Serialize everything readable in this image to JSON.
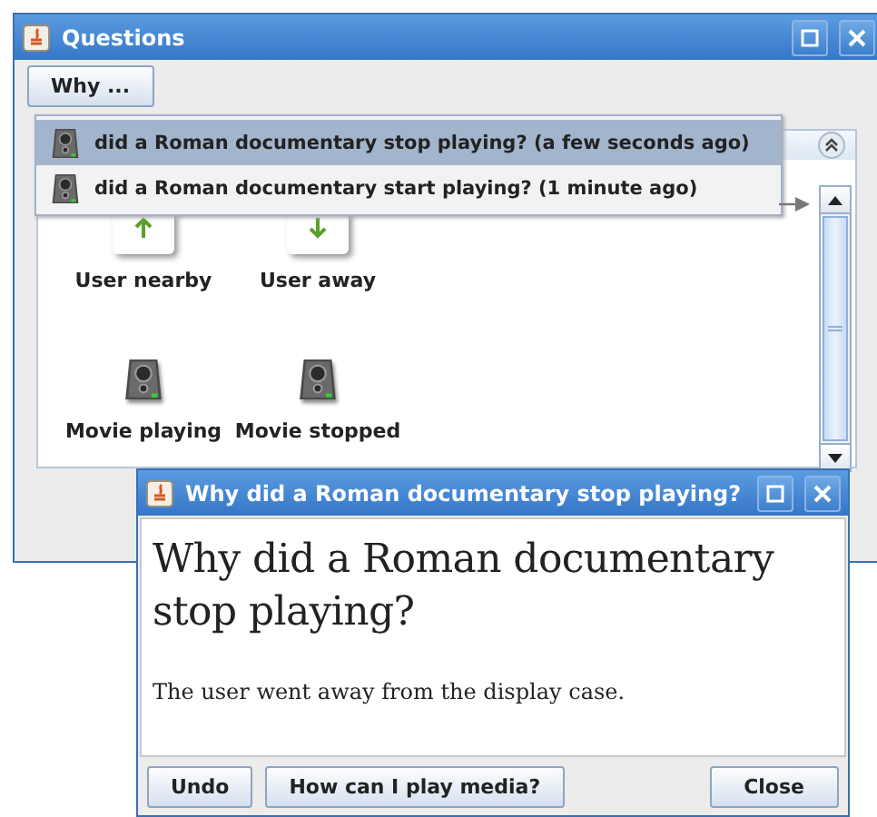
{
  "main_window": {
    "title": "Questions",
    "why_button": "Why ...",
    "menu": [
      {
        "text": "did a Roman documentary stop playing? (a few seconds ago)",
        "selected": true
      },
      {
        "text": "did a Roman documentary start playing? (1 minute ago)",
        "selected": false
      }
    ],
    "items": [
      {
        "label": "User nearby",
        "kind": "up"
      },
      {
        "label": "User away",
        "kind": "down"
      },
      {
        "label": "Movie playing",
        "kind": "speaker"
      },
      {
        "label": "Movie stopped",
        "kind": "speaker"
      }
    ]
  },
  "dialog": {
    "title": "Why did a Roman documentary stop playing?",
    "heading": "Why did a Roman documentary stop playing?",
    "body": "The user went away from the display case.",
    "buttons": [
      "Undo",
      "How can I play media?"
    ],
    "close_button": "Close"
  }
}
